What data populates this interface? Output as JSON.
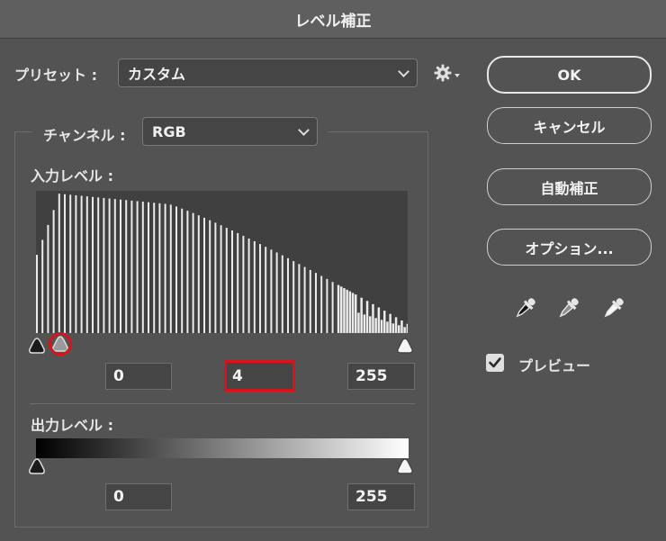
{
  "window": {
    "title": "レベル補正"
  },
  "preset": {
    "label": "プリセット :",
    "value": "カスタム"
  },
  "icons": {
    "settings": "gear-icon",
    "eyedroppers": [
      "black-point-eyedropper-icon",
      "gray-point-eyedropper-icon",
      "white-point-eyedropper-icon"
    ]
  },
  "channel": {
    "label": "チャンネル :",
    "value": "RGB"
  },
  "input_levels": {
    "label": "入力レベル :",
    "shadow": "0",
    "midtone": "4",
    "highlight": "255"
  },
  "output_levels": {
    "label": "出力レベル :",
    "shadow": "0",
    "highlight": "255"
  },
  "buttons": {
    "ok": "OK",
    "cancel": "キャンセル",
    "auto": "自動補正",
    "options": "オプション..."
  },
  "preview": {
    "label": "プレビュー",
    "checked": true
  },
  "colors": {
    "accent_highlight": "#d8131e",
    "background": "#535353"
  }
}
